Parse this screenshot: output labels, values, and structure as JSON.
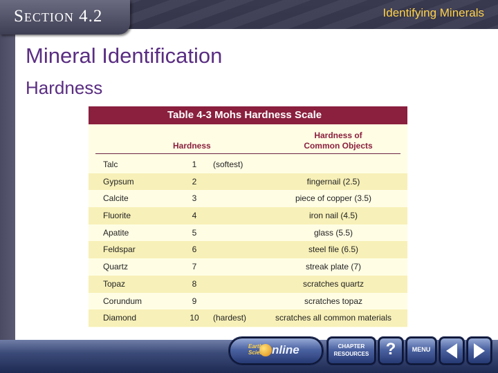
{
  "header": {
    "section_label": "Section 4.2",
    "page_title": "Identifying Minerals"
  },
  "content": {
    "heading": "Mineral Identification",
    "subheading": "Hardness"
  },
  "table": {
    "title": "Table 4-3  Mohs Hardness Scale",
    "col_hardness": "Hardness",
    "col_objects_line1": "Hardness of",
    "col_objects_line2": "Common Objects",
    "rows": [
      {
        "mineral": "Talc",
        "hardness": "1",
        "note": "(softest)",
        "object": ""
      },
      {
        "mineral": "Gypsum",
        "hardness": "2",
        "note": "",
        "object": "fingernail (2.5)"
      },
      {
        "mineral": "Calcite",
        "hardness": "3",
        "note": "",
        "object": "piece of copper (3.5)"
      },
      {
        "mineral": "Fluorite",
        "hardness": "4",
        "note": "",
        "object": "iron nail (4.5)"
      },
      {
        "mineral": "Apatite",
        "hardness": "5",
        "note": "",
        "object": "glass (5.5)"
      },
      {
        "mineral": "Feldspar",
        "hardness": "6",
        "note": "",
        "object": "steel file (6.5)"
      },
      {
        "mineral": "Quartz",
        "hardness": "7",
        "note": "",
        "object": "streak plate (7)"
      },
      {
        "mineral": "Topaz",
        "hardness": "8",
        "note": "",
        "object": "scratches quartz"
      },
      {
        "mineral": "Corundum",
        "hardness": "9",
        "note": "",
        "object": "scratches topaz"
      },
      {
        "mineral": "Diamond",
        "hardness": "10",
        "note": "(hardest)",
        "object": "scratches all common materials"
      }
    ]
  },
  "nav": {
    "earth_small_line1": "Earth",
    "earth_small_line2": "Science",
    "earth_big": "nline",
    "resources_line1": "CHAPTER",
    "resources_line2": "RESOURCES",
    "help": "?",
    "menu": "MENU"
  },
  "colors": {
    "accent_maroon": "#8a1f3e",
    "heading_purple": "#5a2d82",
    "title_gold": "#ffd24a",
    "row_shade": "#f7f0b8"
  }
}
